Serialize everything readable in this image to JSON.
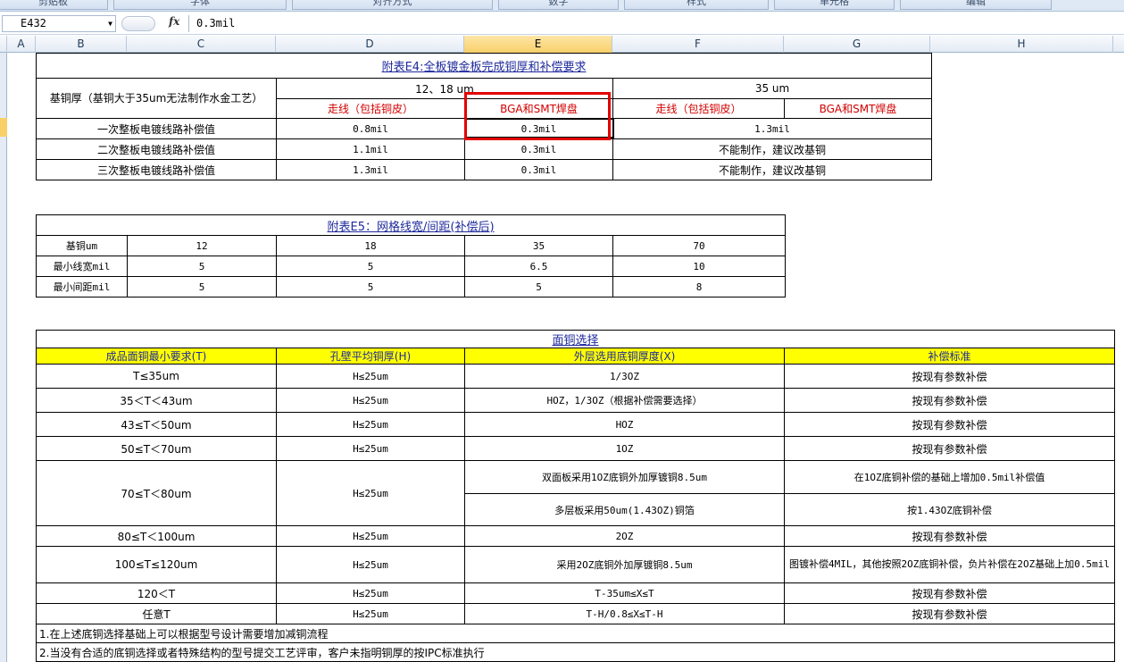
{
  "ribbon": {
    "groups": [
      "剪贴板",
      "字体",
      "对齐方式",
      "数字",
      "样式",
      "单元格",
      "编辑"
    ]
  },
  "formula_bar": {
    "name_box": "E432",
    "fx": "fx",
    "formula": "0.3mil"
  },
  "columns": [
    "A",
    "B",
    "C",
    "D",
    "E",
    "F",
    "G",
    "H"
  ],
  "selected_column": "E",
  "table_e4": {
    "title": "附表E4:全板镀金板完成铜厚和补偿要求",
    "base_label": "基铜厚（基铜大于35um无法制作水金工艺）",
    "group_1": "12、18 um",
    "group_2": "35 um",
    "sub_trace": "走线（包括铜皮）",
    "sub_pad": "BGA和SMT焊盘",
    "rows": [
      {
        "label": "一次整板电镀线路补偿值",
        "v1": "0.8mil",
        "v2": "0.3mil",
        "v3": "1.3mil"
      },
      {
        "label": "二次整板电镀线路补偿值",
        "v1": "1.1mil",
        "v2": "0.3mil",
        "v3": "不能制作，建议改基铜"
      },
      {
        "label": "三次整板电镀线路补偿值",
        "v1": "1.3mil",
        "v2": "0.3mil",
        "v3": "不能制作，建议改基铜"
      }
    ]
  },
  "table_e5": {
    "title": "附表E5：网格线宽/间距(补偿后)",
    "rows": [
      {
        "label": "基铜um",
        "cells": [
          "12",
          "18",
          "35",
          "70"
        ]
      },
      {
        "label": "最小线宽mil",
        "cells": [
          "5",
          "5",
          "6.5",
          "10"
        ]
      },
      {
        "label": "最小间距mil",
        "cells": [
          "5",
          "5",
          "5",
          "8"
        ]
      }
    ]
  },
  "table_face": {
    "title": "面铜选择",
    "headers": [
      "成品面铜最小要求(T)",
      "孔壁平均铜厚(H)",
      "外层选用底铜厚度(X)",
      "补偿标准"
    ],
    "rows": [
      {
        "t": "T≤35um",
        "h": "H≤25um",
        "x": "1/3OZ",
        "c": "按现有参数补偿"
      },
      {
        "t": "35＜T＜43um",
        "h": "H≤25um",
        "x": "HOZ，1/3OZ（根据补偿需要选择）",
        "c": "按现有参数补偿"
      },
      {
        "t": "43≤T＜50um",
        "h": "H≤25um",
        "x": "HOZ",
        "c": "按现有参数补偿"
      },
      {
        "t": "50≤T＜70um",
        "h": "H≤25um",
        "x": "1OZ",
        "c": "按现有参数补偿"
      }
    ],
    "split_row": {
      "t": "70≤T＜80um",
      "h": "H≤25um",
      "x1": "双面板采用1OZ底铜外加厚镀铜8.5um",
      "c1": "在1OZ底铜补偿的基础上增加0.5mil补偿值",
      "x2": "多层板采用50um(1.43OZ)铜箔",
      "c2": "按1.43OZ底铜补偿"
    },
    "rows2": [
      {
        "t": "80≤T＜100um",
        "h": "H≤25um",
        "x": "2OZ",
        "c": "按现有参数补偿"
      }
    ],
    "row_120": {
      "t": "100≤T≤120um",
      "h": "H≤25um",
      "x": "采用2OZ底铜外加厚镀铜8.5um",
      "c": "图镀补偿4MIL，其他按照2OZ底铜补偿，负片补偿在2OZ基础上加0.5mil"
    },
    "rows3": [
      {
        "t": "120＜T",
        "h": "H≤25um",
        "x": "T-35um≤X≤T",
        "c": "按现有参数补偿"
      },
      {
        "t": "任意T",
        "h": "H≤25um",
        "x": "T-H/0.8≤X≤T-H",
        "c": "按现有参数补偿"
      }
    ],
    "notes": [
      "1.在上述底铜选择基础上可以根据型号设计需要增加减铜流程",
      "2.当没有合适的底铜选择或者特殊结构的型号提交工艺评审，客户未指明铜厚的按IPC标准执行"
    ]
  }
}
